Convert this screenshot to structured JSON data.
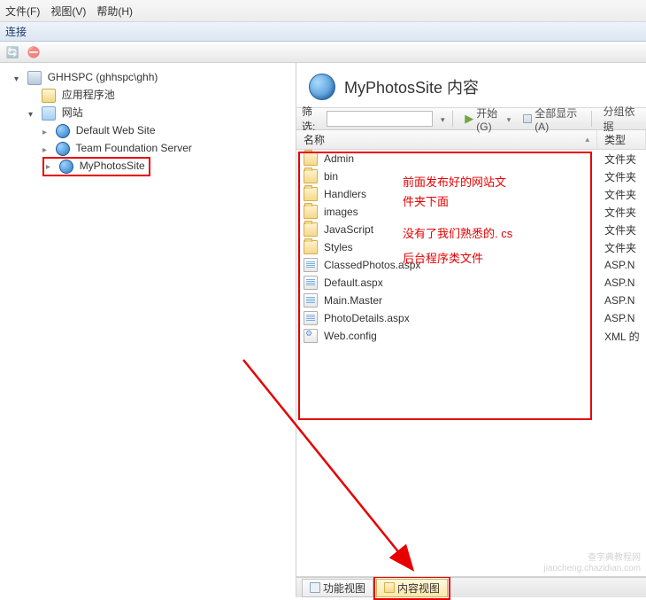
{
  "menu": {
    "file": "文件(F)",
    "view": "视图(V)",
    "help": "帮助(H)"
  },
  "panel": {
    "conn": "连接"
  },
  "tree": {
    "root": "GHHSPC (ghhspc\\ghh)",
    "pool": "应用程序池",
    "sites": "网站",
    "site1": "Default Web Site",
    "site2": "Team Foundation Server",
    "site3": "MyPhotosSite"
  },
  "content": {
    "title": "MyPhotosSite 内容",
    "filter_label": "筛选:",
    "start": "开始(G)",
    "showall": "全部显示(A)",
    "group": "分组依据",
    "col_name": "名称",
    "col_type": "类型",
    "files": [
      {
        "name": "Admin",
        "type": "文件夹",
        "icon": "folder"
      },
      {
        "name": "bin",
        "type": "文件夹",
        "icon": "folder"
      },
      {
        "name": "Handlers",
        "type": "文件夹",
        "icon": "folder"
      },
      {
        "name": "images",
        "type": "文件夹",
        "icon": "folder"
      },
      {
        "name": "JavaScript",
        "type": "文件夹",
        "icon": "folder"
      },
      {
        "name": "Styles",
        "type": "文件夹",
        "icon": "folder"
      },
      {
        "name": "ClassedPhotos.aspx",
        "type": "ASP.N",
        "icon": "aspx"
      },
      {
        "name": "Default.aspx",
        "type": "ASP.N",
        "icon": "aspx"
      },
      {
        "name": "Main.Master",
        "type": "ASP.N",
        "icon": "aspx"
      },
      {
        "name": "PhotoDetails.aspx",
        "type": "ASP.N",
        "icon": "aspx"
      },
      {
        "name": "Web.config",
        "type": "XML 的",
        "icon": "config"
      }
    ]
  },
  "annotations": {
    "line1": "前面发布好的网站文",
    "line2": "件夹下面",
    "line3": "没有了我们熟悉的. cs",
    "line4": "后台程序类文件"
  },
  "tabs": {
    "features": "功能视图",
    "content": "内容视图"
  },
  "watermark": {
    "line1": "查字典教程网",
    "line2": "jiaocheng.chazidian.com"
  }
}
